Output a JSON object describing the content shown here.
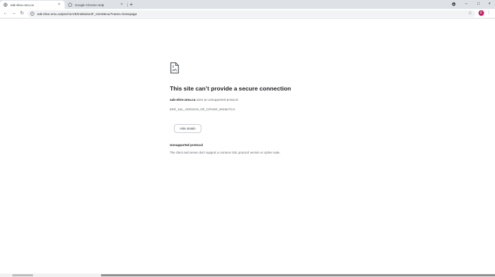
{
  "tabs": [
    {
      "title": "sab-nlive.omu.ca",
      "active": true
    },
    {
      "title": "Google Chrome Help",
      "active": false
    }
  ],
  "toolbar": {
    "url_host": "sab-nlive.omu.ca",
    "url_path": "/psc/HLIVE/EMPLOYEE/HRMS/c/NUI_FRAMEWORK.PT_LANDINGPAGE.GBL",
    "url_display": "sab-nlive.omu.ca/psc/HLIVE/Institution/F_GenMenu/?name=homepage",
    "avatar_letter": "E"
  },
  "error": {
    "heading": "This site can’t provide a secure connection",
    "host": "sab-nlive.omu.ca",
    "sub_text": " uses an unsupported protocol.",
    "code": "ERR_SSL_VERSION_OR_CIPHER_MISMATCH",
    "hide_details_label": "Hide details",
    "detail_title": "Unsupported protocol",
    "detail_body": "The client and server don't support a common SSL protocol version or cipher suite."
  },
  "colors": {
    "tabstrip": "#dee1e6",
    "accent_avatar": "#c2185b",
    "heading": "#202124",
    "muted": "#5f6368"
  }
}
